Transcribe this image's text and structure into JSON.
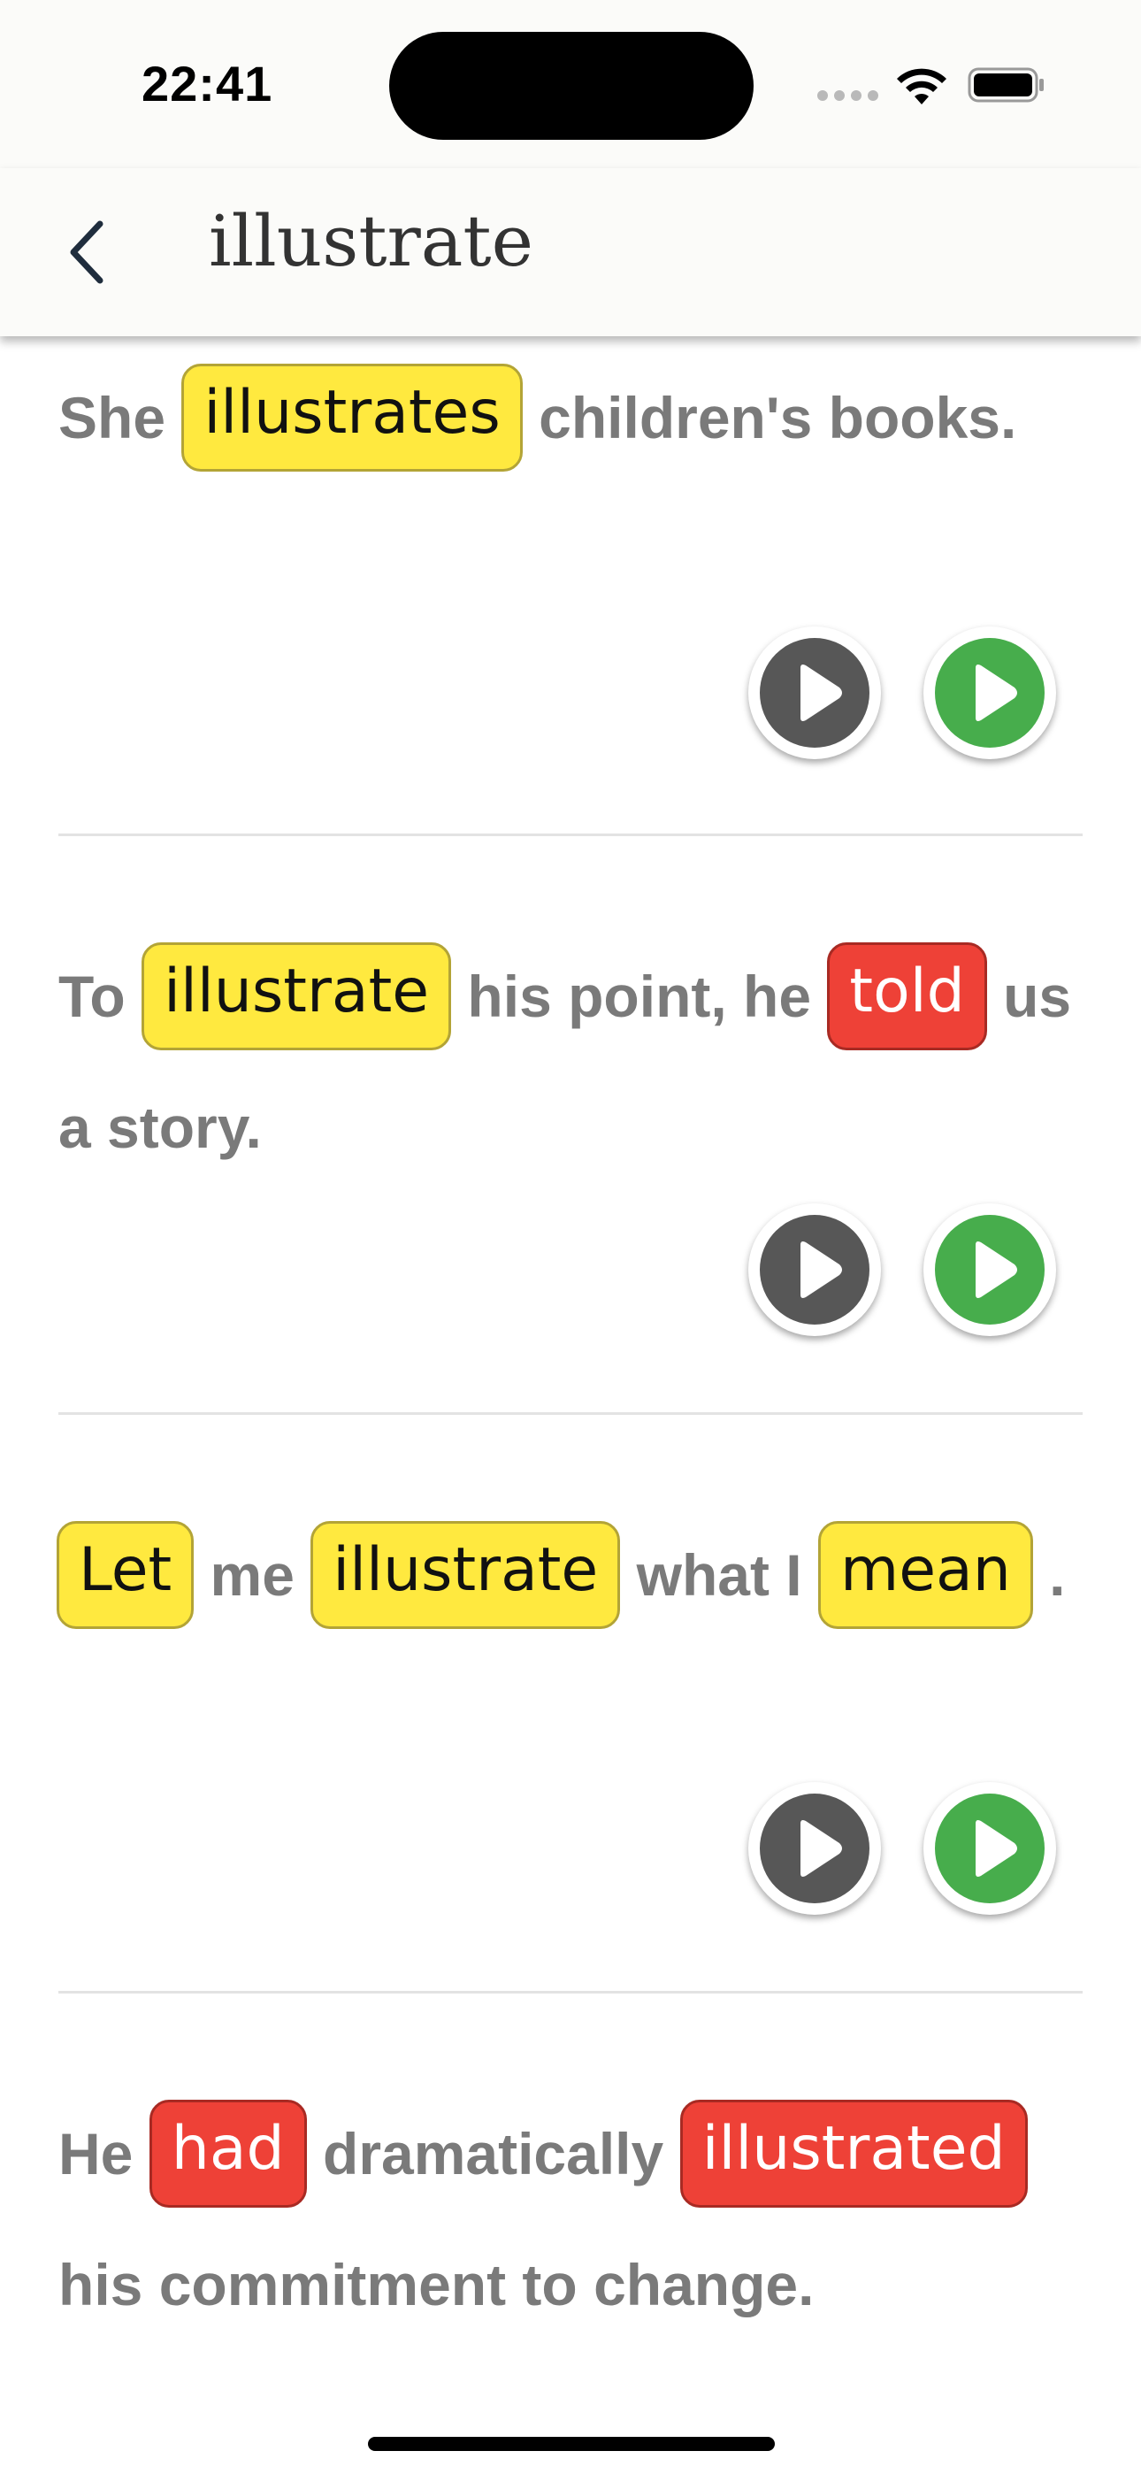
{
  "status_bar": {
    "time": "22:41"
  },
  "nav": {
    "title": "illustrate"
  },
  "sentences": [
    {
      "parts": [
        {
          "text": "She",
          "type": "plain"
        },
        {
          "text": "illustrates",
          "type": "known"
        },
        {
          "text": "children's",
          "type": "plain"
        },
        {
          "text": "books.",
          "type": "plain"
        }
      ]
    },
    {
      "parts": [
        {
          "text": "To",
          "type": "plain"
        },
        {
          "text": "illustrate",
          "type": "known"
        },
        {
          "text": "his point, he",
          "type": "plain"
        },
        {
          "text": "told",
          "type": "unknown"
        },
        {
          "text": "us a story.",
          "type": "plain"
        }
      ]
    },
    {
      "parts": [
        {
          "text": "Let",
          "type": "known"
        },
        {
          "text": "me",
          "type": "plain"
        },
        {
          "text": "illustrate",
          "type": "known"
        },
        {
          "text": "what I",
          "type": "plain"
        },
        {
          "text": "mean",
          "type": "known"
        },
        {
          "text": ".",
          "type": "plain"
        }
      ]
    },
    {
      "parts": [
        {
          "text": "He",
          "type": "plain"
        },
        {
          "text": "had",
          "type": "unknown"
        },
        {
          "text": "dramatically",
          "type": "plain"
        },
        {
          "text": "illustrated",
          "type": "unknown"
        },
        {
          "text": "his commitment to",
          "type": "plain"
        },
        {
          "text": "change.",
          "type": "plain"
        }
      ]
    }
  ],
  "icons": {
    "back": "chevron-left-icon",
    "play_normal": "play-icon",
    "play_slow": "play-slow-icon"
  },
  "colors": {
    "known_chip": "#ffe93f",
    "unknown_chip": "#ee4137",
    "play_normal": "#575757",
    "play_slow": "#47ad4c",
    "sentence_text": "#7a7a7a"
  }
}
